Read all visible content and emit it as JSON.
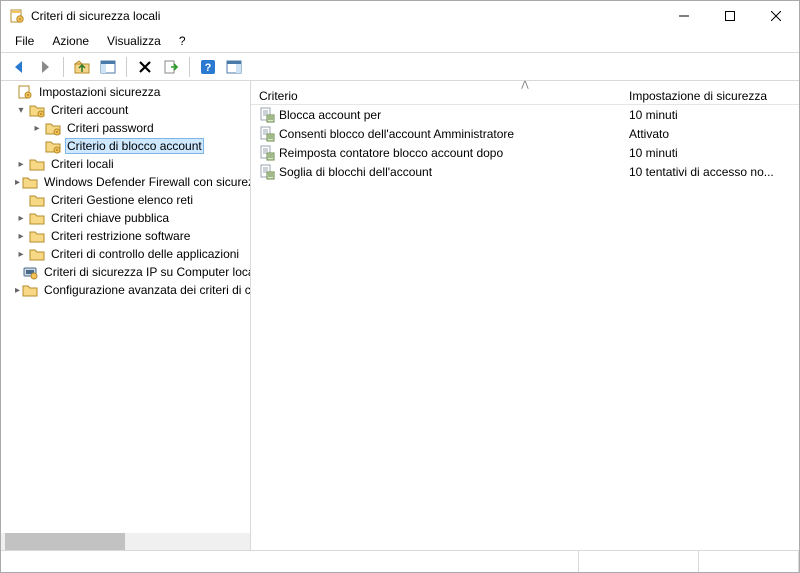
{
  "window": {
    "title": "Criteri di sicurezza locali"
  },
  "menubar": {
    "file": "File",
    "action": "Azione",
    "view": "Visualizza",
    "help": "?"
  },
  "tree": {
    "root": "Impostazioni sicurezza",
    "account": "Criteri account",
    "password": "Criteri password",
    "lockout": "Criterio di blocco account",
    "local": "Criteri locali",
    "firewall": "Windows Defender Firewall con sicurezza avanzata",
    "netlist": "Criteri Gestione elenco reti",
    "pubkey": "Criteri chiave pubblica",
    "restrict": "Criteri restrizione software",
    "appctrl": "Criteri di controllo delle applicazioni",
    "ipsec": "Criteri di sicurezza IP su Computer locale",
    "advaudit": "Configurazione avanzata dei criteri di controllo"
  },
  "columns": {
    "c1": "Criterio",
    "c2": "Impostazione di sicurezza"
  },
  "rows": {
    "r0n": "Blocca account per",
    "r0v": "10 minuti",
    "r1n": "Consenti blocco dell'account Amministratore",
    "r1v": "Attivato",
    "r2n": "Reimposta contatore blocco account dopo",
    "r2v": "10 minuti",
    "r3n": "Soglia di blocchi dell'account",
    "r3v": "10 tentativi di accesso no..."
  }
}
